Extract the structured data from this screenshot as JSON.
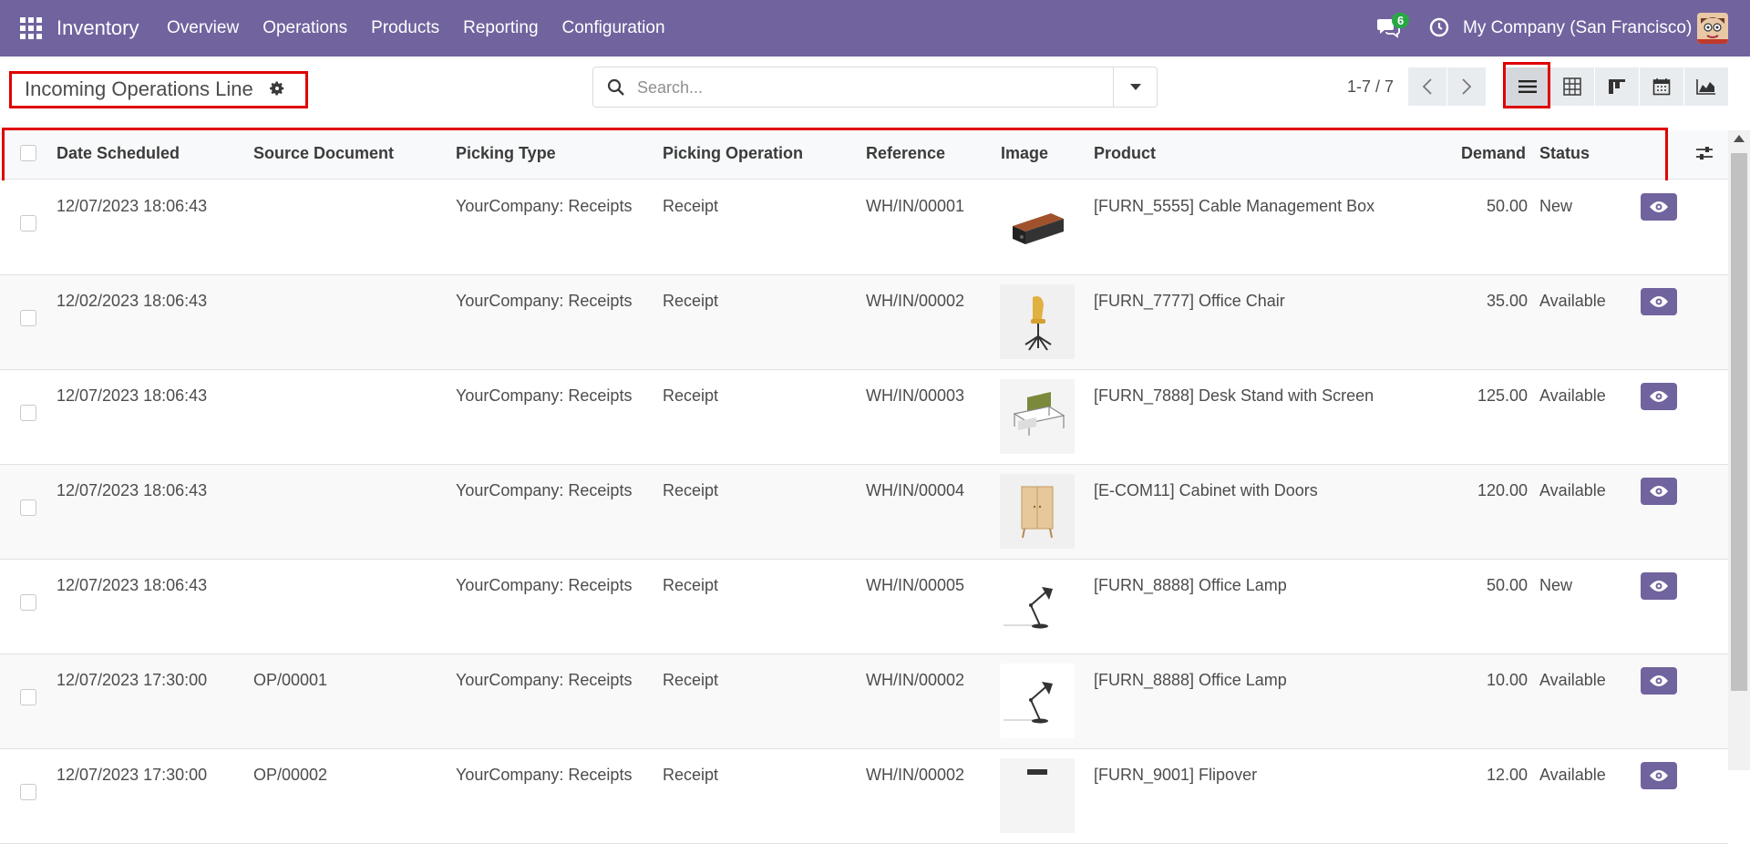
{
  "navbar": {
    "app_name": "Inventory",
    "menu": [
      "Overview",
      "Operations",
      "Products",
      "Reporting",
      "Configuration"
    ],
    "chat_count": "6",
    "company": "My Company (San Francisco)",
    "bg_color": "#71639e"
  },
  "control": {
    "title": "Incoming Operations Line",
    "search_placeholder": "Search...",
    "pager": "1-7 / 7",
    "views": [
      "list-icon",
      "pivot-icon",
      "kanban-icon",
      "calendar-icon",
      "graph-icon"
    ],
    "active_view": "list"
  },
  "table": {
    "headers": [
      "Date Scheduled",
      "Source Document",
      "Picking Type",
      "Picking Operation",
      "Reference",
      "Image",
      "Product",
      "Demand",
      "Status"
    ],
    "rows": [
      {
        "date": "12/07/2023 18:06:43",
        "source": "",
        "picking_type": "YourCompany: Receipts",
        "operation": "Receipt",
        "reference": "WH/IN/00001",
        "product": "[FURN_5555] Cable Management Box",
        "demand": "50.00",
        "status": "New",
        "image": "cable-box"
      },
      {
        "date": "12/02/2023 18:06:43",
        "source": "",
        "picking_type": "YourCompany: Receipts",
        "operation": "Receipt",
        "reference": "WH/IN/00002",
        "product": "[FURN_7777] Office Chair",
        "demand": "35.00",
        "status": "Available",
        "image": "office-chair"
      },
      {
        "date": "12/07/2023 18:06:43",
        "source": "",
        "picking_type": "YourCompany: Receipts",
        "operation": "Receipt",
        "reference": "WH/IN/00003",
        "product": "[FURN_7888] Desk Stand with Screen",
        "demand": "125.00",
        "status": "Available",
        "image": "desk-stand"
      },
      {
        "date": "12/07/2023 18:06:43",
        "source": "",
        "picking_type": "YourCompany: Receipts",
        "operation": "Receipt",
        "reference": "WH/IN/00004",
        "product": "[E-COM11] Cabinet with Doors",
        "demand": "120.00",
        "status": "Available",
        "image": "cabinet"
      },
      {
        "date": "12/07/2023 18:06:43",
        "source": "",
        "picking_type": "YourCompany: Receipts",
        "operation": "Receipt",
        "reference": "WH/IN/00005",
        "product": "[FURN_8888] Office Lamp",
        "demand": "50.00",
        "status": "New",
        "image": "office-lamp"
      },
      {
        "date": "12/07/2023 17:30:00",
        "source": "OP/00001",
        "picking_type": "YourCompany: Receipts",
        "operation": "Receipt",
        "reference": "WH/IN/00002",
        "product": "[FURN_8888] Office Lamp",
        "demand": "10.00",
        "status": "Available",
        "image": "office-lamp"
      },
      {
        "date": "12/07/2023 17:30:00",
        "source": "OP/00002",
        "picking_type": "YourCompany: Receipts",
        "operation": "Receipt",
        "reference": "WH/IN/00002",
        "product": "[FURN_9001] Flipover",
        "demand": "12.00",
        "status": "Available",
        "image": "flipover"
      }
    ]
  }
}
